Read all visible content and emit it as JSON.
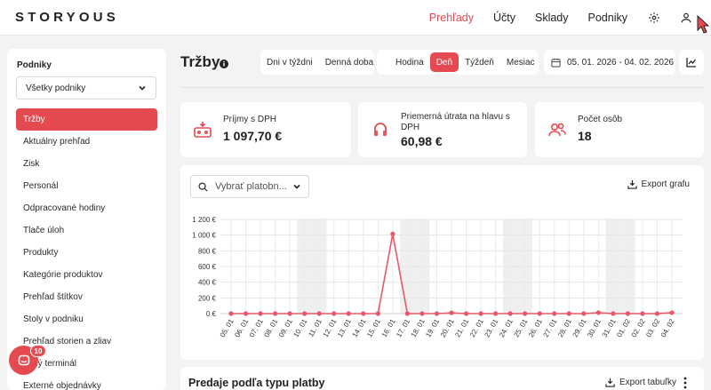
{
  "brand": {
    "logo": "STORYOUS",
    "accent": "#e54a50"
  },
  "nav": {
    "items": [
      {
        "label": "Prehľady",
        "active": true
      },
      {
        "label": "Účty",
        "active": false
      },
      {
        "label": "Sklady",
        "active": false
      },
      {
        "label": "Podniky",
        "active": false
      }
    ],
    "icons": [
      "gear-icon",
      "user-icon"
    ]
  },
  "sidebar": {
    "title": "Podniky",
    "select_value": "Všetky podniky",
    "items": [
      {
        "label": "Tržby",
        "active": true
      },
      {
        "label": "Aktuálny prehľad"
      },
      {
        "label": "Zisk"
      },
      {
        "label": "Personál"
      },
      {
        "label": "Odpracované hodiny"
      },
      {
        "label": "Tlače úloh"
      },
      {
        "label": "Produkty"
      },
      {
        "label": "Kategórie produktov"
      },
      {
        "label": "Prehľad štítkov"
      },
      {
        "label": "Stoly v podniku"
      },
      {
        "label": "Prehľad storien a zliav"
      },
      {
        "label": "obný terminál"
      },
      {
        "label": "Externé objednávky"
      }
    ]
  },
  "chat": {
    "badge": "10"
  },
  "page": {
    "title": "Tržby",
    "filters_a": [
      "Dni v týždni",
      "Denná doba"
    ],
    "filters_b": [
      {
        "label": "Hodina",
        "active": false
      },
      {
        "label": "Deň",
        "active": true
      },
      {
        "label": "Týždeň",
        "active": false
      },
      {
        "label": "Mesiac",
        "active": false
      }
    ],
    "date_range": "05. 01. 2026 - 04. 02. 2026"
  },
  "kpis": [
    {
      "label": "Príjmy s DPH",
      "value": "1 097,70 €",
      "icon": "cash-register-icon"
    },
    {
      "label": "Priemerná útrata na hlavu s DPH",
      "value": "60,98 €",
      "icon": "headset-icon"
    },
    {
      "label": "Počet osôb",
      "value": "18",
      "icon": "users-icon"
    }
  ],
  "chart_card": {
    "payment_placeholder": "Vybrať platobn...",
    "export_label": "Export grafu"
  },
  "chart_data": {
    "type": "line",
    "x": [
      "05. 01",
      "06. 01",
      "07. 01",
      "08. 01",
      "09. 01",
      "10. 01",
      "11. 01",
      "12. 01",
      "13. 01",
      "14. 01",
      "15. 01",
      "16. 01",
      "17. 01",
      "18. 01",
      "19. 01",
      "20. 01",
      "21. 01",
      "22. 01",
      "23. 01",
      "24. 01",
      "25. 01",
      "26. 01",
      "27. 01",
      "28. 01",
      "29. 01",
      "30. 01",
      "31. 01",
      "01. 02",
      "02. 02",
      "03. 02",
      "04. 02"
    ],
    "values": [
      0,
      0,
      0,
      0,
      0,
      0,
      0,
      0,
      0,
      0,
      0,
      1015,
      0,
      0,
      0,
      10,
      0,
      0,
      0,
      0,
      0,
      0,
      0,
      0,
      0,
      12,
      0,
      0,
      0,
      0,
      12
    ],
    "yticks": [
      "0 €",
      "200 €",
      "400 €",
      "600 €",
      "800 €",
      "1 000 €",
      "1 200 €"
    ],
    "ylim": [
      0,
      1200
    ],
    "grid": true,
    "color": "#e8566a",
    "weekend_bands": [
      [
        5,
        6
      ],
      [
        12,
        13
      ],
      [
        19,
        20
      ],
      [
        26,
        27
      ]
    ]
  },
  "table_card": {
    "title": "Predaje podľa typu platby",
    "export_label": "Export tabuľky"
  }
}
